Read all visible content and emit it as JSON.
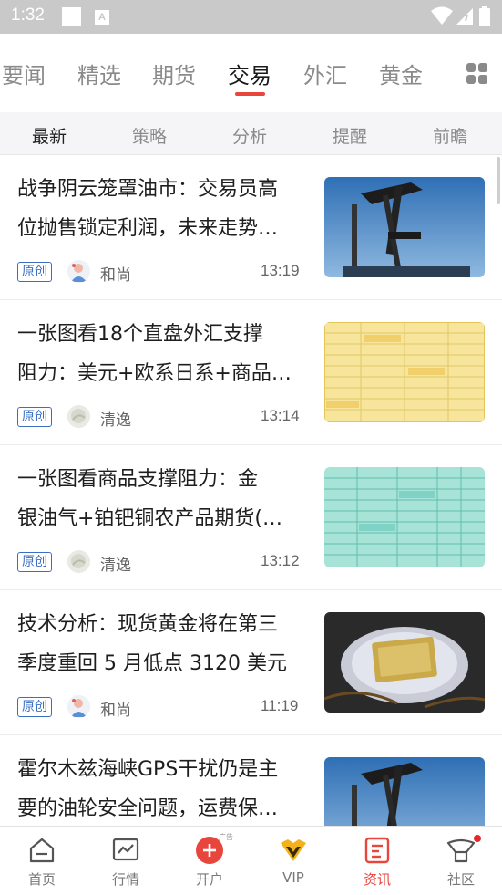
{
  "status_bar": {
    "time": "1:32",
    "a_icon": "A"
  },
  "channel_tabs": [
    "要闻",
    "精选",
    "期货",
    "交易",
    "外汇",
    "黄金"
  ],
  "channel_active": "交易",
  "sub_tabs": [
    "最新",
    "策略",
    "分析",
    "提醒",
    "前瞻"
  ],
  "sub_active": "最新",
  "articles": [
    {
      "title_line1": "战争阴云笼罩油市：交易员高",
      "title_line2": "位抛售锁定利润，未来走势…",
      "badge": "原创",
      "author": "和尚",
      "time": "13:19",
      "thumb": "oil-pumpjack"
    },
    {
      "title_line1": "一张图看18个直盘外汇支撑",
      "title_line2": "阻力：美元+欧系日系+商品…",
      "badge": "原创",
      "author": "清逸",
      "time": "13:14",
      "thumb": "yellow-table"
    },
    {
      "title_line1": "一张图看商品支撑阻力：金",
      "title_line2": "银油气+铂钯铜农产品期货(…",
      "badge": "原创",
      "author": "清逸",
      "time": "13:12",
      "thumb": "teal-table"
    },
    {
      "title_line1": "技术分析：现货黄金将在第三",
      "title_line2": "季度重回 5 月低点 3120 美元",
      "badge": "原创",
      "author": "和尚",
      "time": "11:19",
      "thumb": "gold-bar"
    },
    {
      "title_line1": "霍尔木兹海峡GPS干扰仍是主",
      "title_line2": "要的油轮安全问题，运费保…",
      "badge": "",
      "author": "",
      "time": "",
      "thumb": "oil-pumpjack"
    }
  ],
  "bottom_nav": [
    {
      "label": "首页",
      "icon": "home-icon"
    },
    {
      "label": "行情",
      "icon": "chart-icon"
    },
    {
      "label": "开户",
      "icon": "plus-icon",
      "ad": "广告"
    },
    {
      "label": "VIP",
      "icon": "vip-crown-icon"
    },
    {
      "label": "资讯",
      "icon": "news-icon"
    },
    {
      "label": "社区",
      "icon": "community-icon"
    }
  ],
  "bottom_active": "资讯",
  "colors": {
    "accent": "#e8453c",
    "badge_blue": "#3a6fc4",
    "status_bar": "#c9c9c9"
  }
}
